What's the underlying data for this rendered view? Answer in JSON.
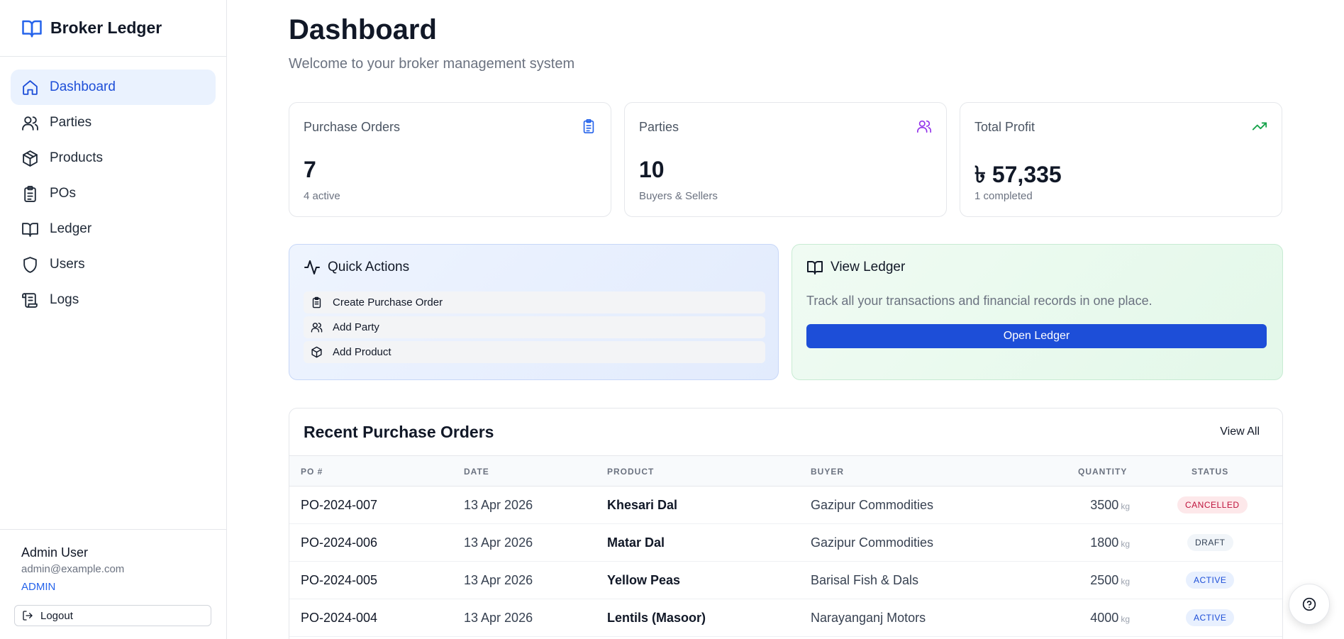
{
  "app": {
    "name": "Broker Ledger",
    "brand_color": "#2563eb"
  },
  "sidebar": {
    "items": [
      {
        "label": "Dashboard",
        "icon": "home-icon",
        "active": true
      },
      {
        "label": "Parties",
        "icon": "users-icon"
      },
      {
        "label": "Products",
        "icon": "package-icon"
      },
      {
        "label": "POs",
        "icon": "clipboard-icon"
      },
      {
        "label": "Ledger",
        "icon": "book-icon"
      },
      {
        "label": "Users",
        "icon": "shield-icon"
      },
      {
        "label": "Logs",
        "icon": "scroll-icon"
      }
    ],
    "user": {
      "name": "Admin User",
      "email": "admin@example.com",
      "role": "ADMIN"
    },
    "logout_label": "Logout"
  },
  "header": {
    "title": "Dashboard",
    "subtitle": "Welcome to your broker management system"
  },
  "stats": [
    {
      "label": "Purchase Orders",
      "value": "7",
      "sub": "4 active",
      "icon": "clipboard-icon",
      "color": "#2563eb"
    },
    {
      "label": "Parties",
      "value": "10",
      "sub": "Buyers & Sellers",
      "icon": "users-icon",
      "color": "#9333ea"
    },
    {
      "label": "Total Profit",
      "value": "৳ 57,335",
      "sub": "1 completed",
      "icon": "trending-up-icon",
      "color": "#16a34a"
    }
  ],
  "quick_actions": {
    "title": "Quick Actions",
    "items": [
      {
        "label": "Create Purchase Order",
        "icon": "clipboard-icon"
      },
      {
        "label": "Add Party",
        "icon": "users-icon"
      },
      {
        "label": "Add Product",
        "icon": "package-icon"
      }
    ]
  },
  "view_ledger": {
    "title": "View Ledger",
    "text": "Track all your transactions and financial records in one place.",
    "button": "Open Ledger"
  },
  "recent_orders": {
    "title": "Recent Purchase Orders",
    "view_all": "View All",
    "columns": [
      "PO #",
      "DATE",
      "PRODUCT",
      "BUYER",
      "QUANTITY",
      "STATUS"
    ],
    "rows": [
      {
        "po": "PO-2024-007",
        "date": "13 Apr 2026",
        "product": "Khesari Dal",
        "buyer": "Gazipur Commodities",
        "quantity": "3500",
        "unit": "kg",
        "status": "CANCELLED"
      },
      {
        "po": "PO-2024-006",
        "date": "13 Apr 2026",
        "product": "Matar Dal",
        "buyer": "Gazipur Commodities",
        "quantity": "1800",
        "unit": "kg",
        "status": "DRAFT"
      },
      {
        "po": "PO-2024-005",
        "date": "13 Apr 2026",
        "product": "Yellow Peas",
        "buyer": "Barisal Fish & Dals",
        "quantity": "2500",
        "unit": "kg",
        "status": "ACTIVE"
      },
      {
        "po": "PO-2024-004",
        "date": "13 Apr 2026",
        "product": "Lentils (Masoor)",
        "buyer": "Narayanganj Motors",
        "quantity": "4000",
        "unit": "kg",
        "status": "ACTIVE"
      }
    ]
  },
  "help": {
    "icon": "help-circle-icon"
  }
}
